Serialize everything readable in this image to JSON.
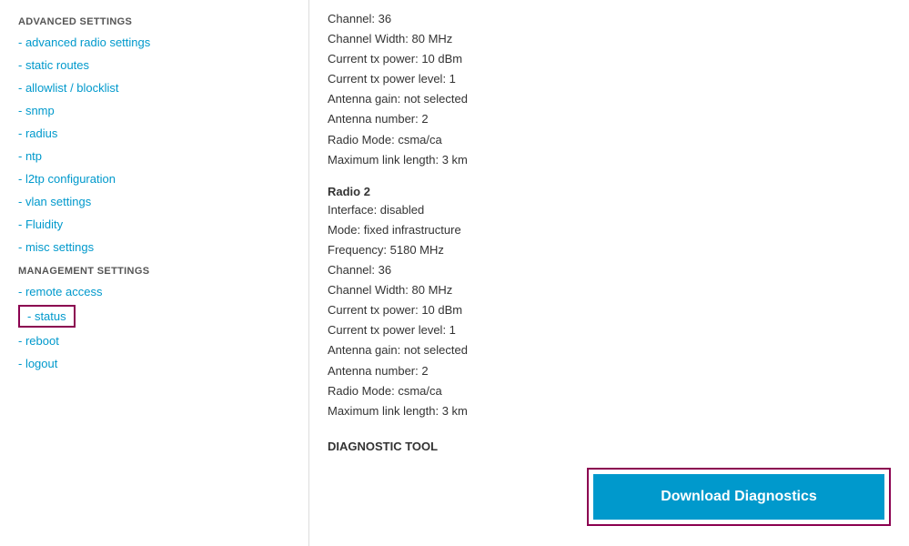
{
  "sidebar": {
    "advanced_settings_title": "ADVANCED SETTINGS",
    "management_settings_title": "MANAGEMENT SETTINGS",
    "links_advanced": [
      {
        "label": "- advanced radio settings",
        "name": "advanced-radio-settings",
        "active": false
      },
      {
        "label": "- static routes",
        "name": "static-routes",
        "active": false
      },
      {
        "label": "- allowlist / blocklist",
        "name": "allowlist-blocklist",
        "active": false
      },
      {
        "label": "- snmp",
        "name": "snmp",
        "active": false
      },
      {
        "label": "- radius",
        "name": "radius",
        "active": false
      },
      {
        "label": "- ntp",
        "name": "ntp",
        "active": false
      },
      {
        "label": "- l2tp configuration",
        "name": "l2tp-configuration",
        "active": false
      },
      {
        "label": "- vlan settings",
        "name": "vlan-settings",
        "active": false
      },
      {
        "label": "- Fluidity",
        "name": "fluidity",
        "active": false
      },
      {
        "label": "- misc settings",
        "name": "misc-settings",
        "active": false
      }
    ],
    "links_management": [
      {
        "label": "- remote access",
        "name": "remote-access",
        "active": false
      },
      {
        "label": "- status",
        "name": "status",
        "active": true
      },
      {
        "label": "- reboot",
        "name": "reboot",
        "active": false
      },
      {
        "label": "- logout",
        "name": "logout",
        "active": false
      }
    ]
  },
  "main": {
    "radio1": {
      "title": "Radio 2",
      "lines": [
        "Interface: disabled",
        "Mode: fixed infrastructure",
        "Frequency: 5180 MHz",
        "Channel: 36",
        "Channel Width: 80 MHz",
        "Current tx power: 10 dBm",
        "Current tx power level: 1",
        "Antenna gain: not selected",
        "Antenna number: 2",
        "Radio Mode: csma/ca",
        "Maximum link length: 3 km"
      ]
    },
    "above_radio1": {
      "lines": [
        "Channel: 36",
        "Channel Width: 80 MHz",
        "Current tx power: 10 dBm",
        "Current tx power level: 1",
        "Antenna gain: not selected",
        "Antenna number: 2",
        "Radio Mode: csma/ca",
        "Maximum link length: 3 km"
      ]
    },
    "diagnostic_heading": "DIAGNOSTIC TOOL",
    "download_button_label": "Download Diagnostics"
  }
}
